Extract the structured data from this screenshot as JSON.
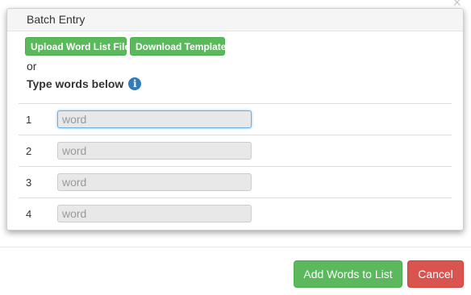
{
  "dialog": {
    "close_glyph": "×",
    "panel_title": "Batch Entry",
    "upload_label": "Upload Word List File",
    "template_label": "Download Template",
    "or_text": "or",
    "type_label": "Type words below",
    "info_icon": "info-icon"
  },
  "rows": [
    {
      "number": "1",
      "placeholder": "word",
      "value": ""
    },
    {
      "number": "2",
      "placeholder": "word",
      "value": ""
    },
    {
      "number": "3",
      "placeholder": "word",
      "value": ""
    },
    {
      "number": "4",
      "placeholder": "word",
      "value": ""
    }
  ],
  "footer": {
    "add_label": "Add Words to List",
    "cancel_label": "Cancel"
  },
  "colors": {
    "success": "#5cb85c",
    "danger": "#d9534f",
    "info": "#337ab7"
  }
}
